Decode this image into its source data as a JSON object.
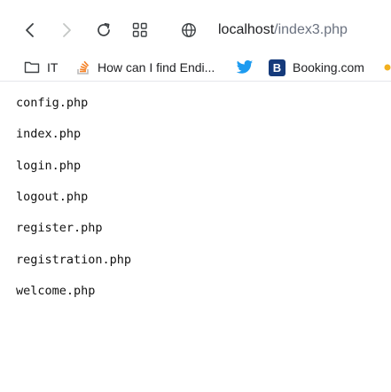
{
  "browser": {
    "url_host": "localhost",
    "url_path": "/index3.php"
  },
  "bookmarks": [
    {
      "label": "IT",
      "icon": "folder-icon"
    },
    {
      "label": "How can I find Endi...",
      "icon": "stackoverflow-icon"
    },
    {
      "label": "",
      "icon": "twitter-icon"
    },
    {
      "label": "Booking.com",
      "icon": "booking-icon",
      "badge": "B"
    }
  ],
  "files": [
    "config.php",
    "index.php",
    "login.php",
    "logout.php",
    "register.php",
    "registration.php",
    "welcome.php"
  ],
  "colors": {
    "text": "#202124",
    "url_path": "#6b7280",
    "twitter": "#1d9bf0",
    "booking": "#153a7b",
    "stackoverflow": "#f48024"
  }
}
